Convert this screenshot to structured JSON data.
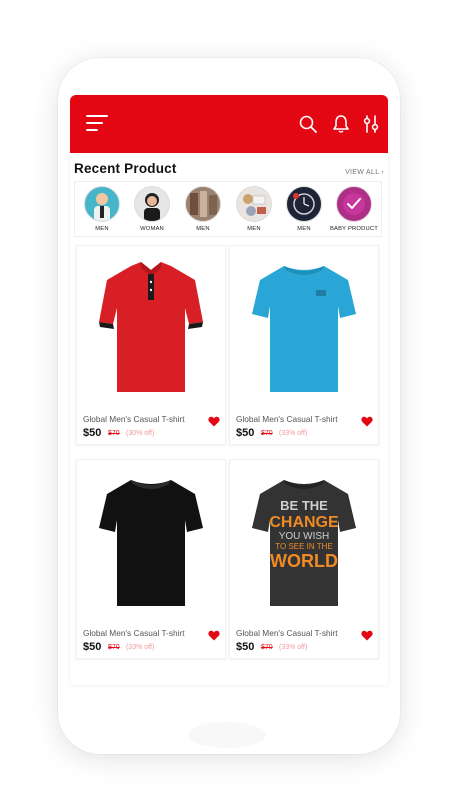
{
  "section": {
    "title": "Recent Product",
    "view_all": "VIEW ALL ›"
  },
  "categories": [
    {
      "label": "MEN",
      "icon": "avatar-men-icon"
    },
    {
      "label": "WOMAN",
      "icon": "avatar-woman-icon"
    },
    {
      "label": "MEN",
      "icon": "avatar-men-icon"
    },
    {
      "label": "MEN",
      "icon": "avatar-men-icon"
    },
    {
      "label": "MEN",
      "icon": "avatar-men-icon"
    },
    {
      "label": "BABY PRODUCT",
      "icon": "avatar-baby-icon"
    }
  ],
  "products": [
    {
      "name": "Global Men's Casual T-shirt",
      "price": "$50",
      "old_price": "$70",
      "discount": "(30% off)",
      "color": "#d81f26"
    },
    {
      "name": "Global Men's Casual T-shirt",
      "price": "$50",
      "old_price": "$70",
      "discount": "(33% off)",
      "color": "#29a6d6"
    },
    {
      "name": "Global Men's Casual T-shirt",
      "price": "$50",
      "old_price": "$70",
      "discount": "(33% off)",
      "color": "#111111"
    },
    {
      "name": "Global Men's Casual T-shirt",
      "price": "$50",
      "old_price": "$70",
      "discount": "(33% off)",
      "color": "#333333",
      "print_lines": [
        "BE THE",
        "CHANGE",
        "YOU WISH",
        "TO SEE IN THE",
        "WORLD"
      ]
    }
  ],
  "colors": {
    "accent": "#e30613",
    "heart": "#e30613"
  }
}
